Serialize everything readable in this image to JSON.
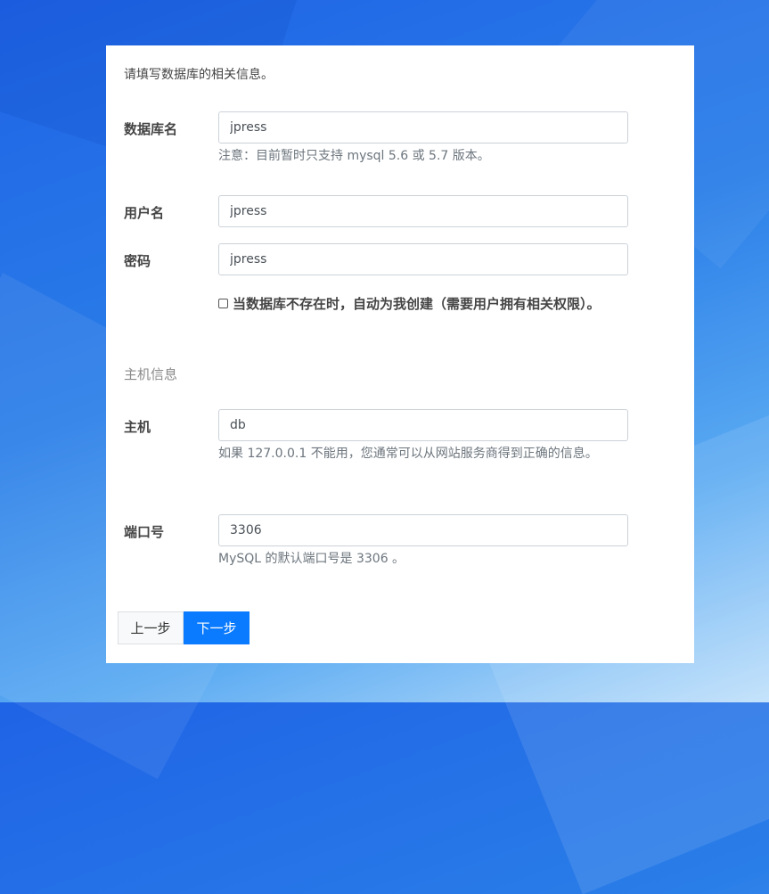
{
  "intro": "请填写数据库的相关信息。",
  "db_name": {
    "label": "数据库名",
    "value": "jpress",
    "help": "注意：目前暂时只支持 mysql 5.6 或 5.7 版本。"
  },
  "db_user": {
    "label": "用户名",
    "value": "jpress"
  },
  "db_password": {
    "label": "密码",
    "value": "jpress"
  },
  "auto_create": {
    "checked": false,
    "label": "当数据库不存在时，自动为我创建（需要用户拥有相关权限）。"
  },
  "host_section_title": "主机信息",
  "db_host": {
    "label": "主机",
    "value": "db",
    "help": "如果 127.0.0.1 不能用，您通常可以从网站服务商得到正确的信息。"
  },
  "db_port": {
    "label": "端口号",
    "value": "3306",
    "help": "MySQL 的默认端口号是 3306 。"
  },
  "buttons": {
    "prev": "上一步",
    "next": "下一步"
  },
  "colors": {
    "primary": "#0a7bff",
    "panel_bg": "#ffffff",
    "muted_text": "#6c757d"
  }
}
